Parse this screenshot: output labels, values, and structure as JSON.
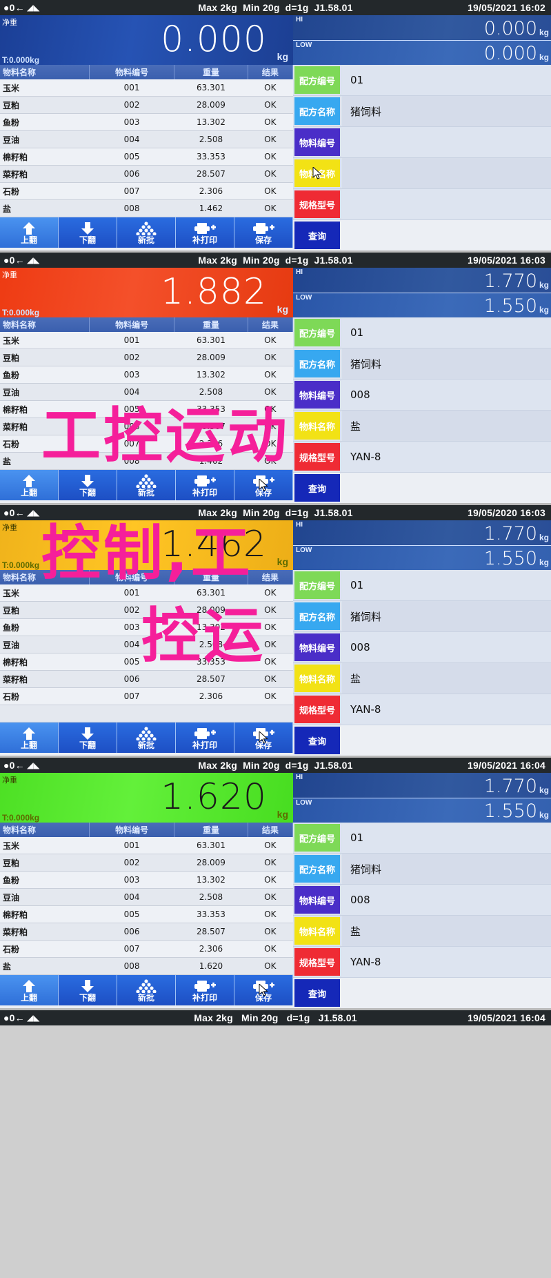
{
  "status": {
    "zero_icon": "zero-indicator-icon",
    "arrow_icon": "left-arrow-icon",
    "stable_icon": "stable-icon",
    "max": "Max 2kg",
    "min": "Min 20g",
    "division": "d=1g",
    "version": "J1.58.01"
  },
  "labels": {
    "net": "净重",
    "tare_prefix": "T:",
    "unit": "kg",
    "hi": "HI",
    "low": "LOW"
  },
  "table": {
    "headers": [
      "物料名称",
      "物料编号",
      "重量",
      "结果"
    ]
  },
  "fieldTags": {
    "recipe_no": "配方编号",
    "recipe_name": "配方名称",
    "material_no": "物料编号",
    "material_name": "物料名称",
    "spec_model": "规格型号"
  },
  "fieldColors": {
    "recipe_no": "#7ed957",
    "recipe_name": "#37a8f0",
    "material_no": "#4a2ec8",
    "material_name": "#f2e215",
    "spec_model": "#ef2b34"
  },
  "toolbar": {
    "page_up": "上翻",
    "page_down": "下翻",
    "new_batch": "新批",
    "reprint": "补打印",
    "save": "保存",
    "query": "查询"
  },
  "panels": [
    {
      "datetime": "19/05/2021  16:02",
      "weight": "0.000",
      "weight_color": "blue",
      "tare": "T:0.000kg",
      "hi": "0.000",
      "low": "0.000",
      "fields": {
        "recipe_no": "01",
        "recipe_name": "猪饲料",
        "material_no": "",
        "material_name": "",
        "spec_model": ""
      },
      "rows": [
        [
          "玉米",
          "001",
          "63.301",
          "OK"
        ],
        [
          "豆粕",
          "002",
          "28.009",
          "OK"
        ],
        [
          "鱼粉",
          "003",
          "13.302",
          "OK"
        ],
        [
          "豆油",
          "004",
          "2.508",
          "OK"
        ],
        [
          "棉籽粕",
          "005",
          "33.353",
          "OK"
        ],
        [
          "菜籽粕",
          "006",
          "28.507",
          "OK"
        ],
        [
          "石粉",
          "007",
          "2.306",
          "OK"
        ],
        [
          "盐",
          "008",
          "1.462",
          "OK"
        ]
      ]
    },
    {
      "datetime": "19/05/2021  16:03",
      "weight": "1.882",
      "weight_color": "red",
      "tare": "T:0.000kg",
      "hi": "1.770",
      "low": "1.550",
      "fields": {
        "recipe_no": "01",
        "recipe_name": "猪饲料",
        "material_no": "008",
        "material_name": "盐",
        "spec_model": "YAN-8"
      },
      "rows": [
        [
          "玉米",
          "001",
          "63.301",
          "OK"
        ],
        [
          "豆粕",
          "002",
          "28.009",
          "OK"
        ],
        [
          "鱼粉",
          "003",
          "13.302",
          "OK"
        ],
        [
          "豆油",
          "004",
          "2.508",
          "OK"
        ],
        [
          "棉籽粕",
          "005",
          "33.353",
          "OK"
        ],
        [
          "菜籽粕",
          "006",
          "28.507",
          "OK"
        ],
        [
          "石粉",
          "007",
          "2.306",
          "OK"
        ],
        [
          "盐",
          "008",
          "1.462",
          "OK"
        ]
      ]
    },
    {
      "datetime": "19/05/2020  16:03",
      "weight": "1.462",
      "weight_color": "amber",
      "tare": "T:0.000kg",
      "hi": "1.770",
      "low": "1.550",
      "fields": {
        "recipe_no": "01",
        "recipe_name": "猪饲料",
        "material_no": "008",
        "material_name": "盐",
        "spec_model": "YAN-8"
      },
      "rows": [
        [
          "玉米",
          "001",
          "63.301",
          "OK"
        ],
        [
          "豆粕",
          "002",
          "28.009",
          "OK"
        ],
        [
          "鱼粉",
          "003",
          "13.302",
          "OK"
        ],
        [
          "豆油",
          "004",
          "2.508",
          "OK"
        ],
        [
          "棉籽粕",
          "005",
          "33.353",
          "OK"
        ],
        [
          "菜籽粕",
          "006",
          "28.507",
          "OK"
        ],
        [
          "石粉",
          "007",
          "2.306",
          "OK"
        ],
        [
          "",
          "",
          "",
          ""
        ]
      ]
    },
    {
      "datetime": "19/05/2021  16:04",
      "weight": "1.620",
      "weight_color": "green",
      "tare": "T:0.000kg",
      "hi": "1.770",
      "low": "1.550",
      "fields": {
        "recipe_no": "01",
        "recipe_name": "猪饲料",
        "material_no": "008",
        "material_name": "盐",
        "spec_model": "YAN-8"
      },
      "rows": [
        [
          "玉米",
          "001",
          "63.301",
          "OK"
        ],
        [
          "豆粕",
          "002",
          "28.009",
          "OK"
        ],
        [
          "鱼粉",
          "003",
          "13.302",
          "OK"
        ],
        [
          "豆油",
          "004",
          "2.508",
          "OK"
        ],
        [
          "棉籽粕",
          "005",
          "33.353",
          "OK"
        ],
        [
          "菜籽粕",
          "006",
          "28.507",
          "OK"
        ],
        [
          "石粉",
          "007",
          "2.306",
          "OK"
        ],
        [
          "盐",
          "008",
          "1.620",
          "OK"
        ]
      ]
    }
  ],
  "watermark": {
    "line1": "工控运动",
    "line2": "控制,工",
    "line3": "控运"
  },
  "footer": {
    "max": "Max 2kg",
    "min": "Min 20g",
    "division": "d=1g",
    "version": "J1.58.01",
    "datetime": "19/05/2021  16:04"
  }
}
